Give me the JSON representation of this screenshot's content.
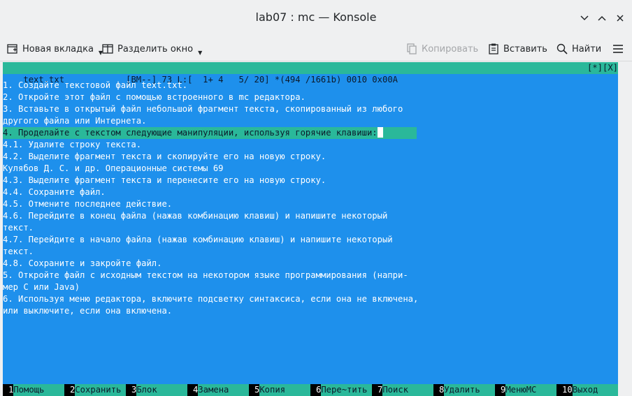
{
  "window": {
    "title": "lab07 : mc — Konsole"
  },
  "toolbar": {
    "new_tab": "Новая вкладка",
    "split": "Разделить окно",
    "copy": "Копировать",
    "paste": "Вставить",
    "find": "Найти"
  },
  "editor": {
    "status_left": "text.txt            [BM--] 73 L:[  1+ 4   5/ 20] *(494 /1661b) 0010 0x00A",
    "status_right": "[*][X]",
    "lines": [
      "1. Создайте текстовой файл text.txt.",
      "2. Откройте этот файл с помощью встроенного в mc редактора.",
      "3. Вставьте в открытый файл небольшой фрагмент текста, скопированный из любого",
      "другого файла или Интернета.",
      "4. Проделайте с текстом следующие манипуляции, используя горячие клавиши:",
      "4.1. Удалите строку текста.",
      "4.2. Выделите фрагмент текста и скопируйте его на новую строку.",
      "Кулябов Д. С. и др. Операционные системы 69",
      "4.3. Выделите фрагмент текста и перенесите его на новую строку.",
      "4.4. Сохраните файл.",
      "4.5. Отмените последнее действие.",
      "4.6. Перейдите в конец файла (нажав комбинацию клавиш) и напишите некоторый",
      "текст.",
      "4.7. Перейдите в начало файла (нажав комбинацию клавиш) и напишите некоторый",
      "текст.",
      "4.8. Сохраните и закройте файл.",
      "5. Откройте файл с исходным текстом на некотором языке программирования (напри-",
      "мер C или Java)",
      "6. Используя меню редактора, включите подсветку синтаксиса, если она не включена,",
      "или выключите, если она включена."
    ]
  },
  "fkeys": [
    {
      "num": "1",
      "label": "Помощь"
    },
    {
      "num": "2",
      "label": "Сохранить"
    },
    {
      "num": "3",
      "label": "Блок"
    },
    {
      "num": "4",
      "label": "Замена"
    },
    {
      "num": "5",
      "label": "Копия"
    },
    {
      "num": "6",
      "label": "Пере~тить"
    },
    {
      "num": "7",
      "label": "Поиск"
    },
    {
      "num": "8",
      "label": "Удалить"
    },
    {
      "num": "9",
      "label": "МенюMC"
    },
    {
      "num": "10",
      "label": "Выход"
    }
  ],
  "colors": {
    "terminal_bg": "#1e90ec",
    "bar_bg": "#2ab89a",
    "chrome_bg": "#eff0f1"
  }
}
